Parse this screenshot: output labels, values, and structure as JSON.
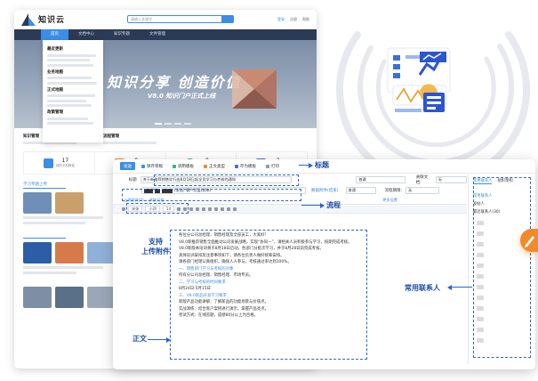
{
  "portal": {
    "logo_text": "知识云",
    "search_placeholder": "请输入关键字",
    "top_links": [
      "登录",
      "注册",
      "帮助"
    ],
    "nav": [
      "首页",
      "文档中心",
      "知识专题",
      "文件管理"
    ],
    "dropdown": {
      "groups": [
        "最近更新",
        "业务地图",
        "正式地图",
        "政策管理"
      ]
    },
    "banner": {
      "headline": "知识分享 创造价值",
      "subline": "V8.0 知识门户正式上线"
    },
    "sections": [
      "知识管理",
      "流程管理"
    ],
    "stats": [
      {
        "value": "17",
        "label": "我的文档数量"
      },
      {
        "value": "0",
        "label": "我的收藏数量"
      },
      {
        "value": "0",
        "label": "下载文档数量"
      },
      {
        "value": "3",
        "label": "我的文档点赞"
      }
    ],
    "card_header": "学习专题上传"
  },
  "editor": {
    "toolbar": [
      {
        "label": "发送",
        "primary": true
      },
      {
        "label": "保存草稿"
      },
      {
        "label": "调用模板"
      },
      {
        "label": "正文类型"
      },
      {
        "label": "存为模板"
      },
      {
        "label": "打印"
      }
    ],
    "fields": {
      "title_label": "标题",
      "title_value": "关于新推荐销售实行由8月18日起全员学习与考核的通知",
      "sender_label": "",
      "flow_value": "(发送) 客户总监(结束)",
      "flow_tail": "数据附件(结束)",
      "priority_label": "普通",
      "importance_label": "普通",
      "relate_doc_label": "关联文档:",
      "relate_doc_value": "无",
      "deadline_label": "流程期限:",
      "deadline_value": "无",
      "more_settings": "更多设置"
    },
    "attach": [
      "上传附件(0)",
      "关联文档"
    ],
    "format_bar": {
      "font": "宋体",
      "size": "小四",
      "size2": "14"
    },
    "doc_lines": [
      {
        "text": "各位分公司总经理、销售经理及全部员工，大家好！",
        "blue": false
      },
      {
        "text": "V8.0新推荐销售全面推动公司发展战略，实现“协同一”，请相关人员积极参与学习，按期完成考核。",
        "blue": false
      },
      {
        "text": "V8.0新版本培训将于8月18日启动，各部门分批次学习，并于8月28日前完成考核。",
        "blue": false
      },
      {
        "text": "具体培训安排及注意事项如下，请各位负责人做好统筹安排。",
        "blue": false
      },
      {
        "text": "请各部门经理认真组织，确保人人参与，考核通过率达到100%。",
        "blue": false
      },
      {
        "text": "一、销售部门学习与考核的对象",
        "blue": true
      },
      {
        "text": "所有分公司总经理、销售经理、市场专员。",
        "blue": false
      },
      {
        "text": "二、学习与考核的时间要求",
        "blue": true
      },
      {
        "text": "8月24日-5月15日",
        "blue": false
      },
      {
        "text": "三、V8.0新品开发学习要求",
        "blue": true
      },
      {
        "text": "新版产品功能讲解：了解新品的功能场景与价值点。",
        "blue": false
      },
      {
        "text": "实战演练：结合客户案例进行演示，掌握产品亮点。",
        "blue": false
      },
      {
        "text": "考试方式：在线答题，成绩80分以上为合格。",
        "blue": false
      }
    ],
    "contacts": {
      "tabs": [
        "常用联系人",
        "组织架构"
      ],
      "section": "常用联系人",
      "items": [
        "发帖人",
        "最近联系人(30)"
      ]
    }
  },
  "annotations": {
    "title": "标题",
    "flow": "流程",
    "upload": "支持\n上传附件",
    "body": "正文",
    "contacts": "常用联系人"
  }
}
